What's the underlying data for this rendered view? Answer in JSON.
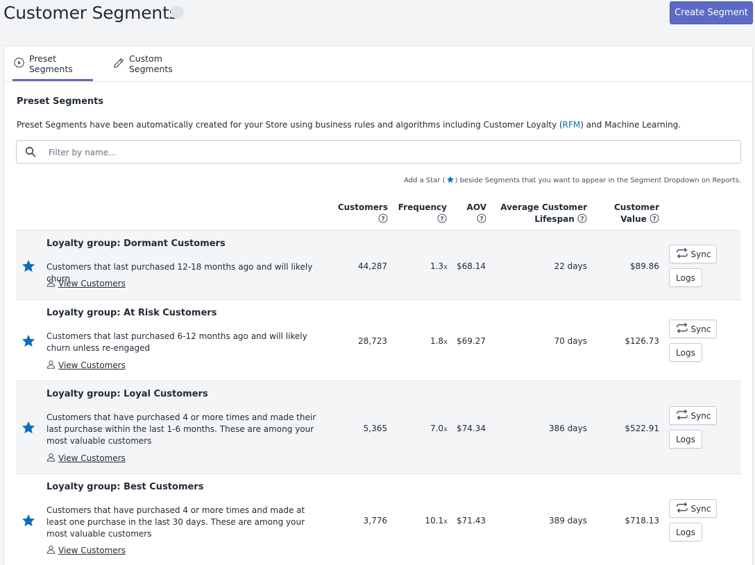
{
  "page": {
    "title": "Customer Segments",
    "create_button": "Create Segment"
  },
  "tabs": [
    {
      "label": "Preset Segments",
      "icon": "preset-icon",
      "active": true
    },
    {
      "label": "Custom Segments",
      "icon": "pencil-icon",
      "active": false
    }
  ],
  "section": {
    "heading": "Preset Segments",
    "desc_before": "Preset Segments have been automatically created for your Store using business rules and algorithms including Customer Loyalty (",
    "desc_link": "RFM",
    "desc_after": ") and Machine Learning."
  },
  "search": {
    "placeholder": "Filter by name...",
    "value": ""
  },
  "hint": {
    "before": "Add a Star (",
    "after": ") beside Segments that you want to appear in the Segment Dropdown on Reports."
  },
  "columns": {
    "customers": "Customers",
    "frequency": "Frequency",
    "aov": "AOV",
    "lifespan_line1": "Average Customer",
    "lifespan_line2": "Lifespan",
    "value_line1": "Customer",
    "value_line2": "Value"
  },
  "row_labels": {
    "view_customers": "View Customers",
    "sync": "Sync",
    "logs": "Logs",
    "freq_suffix": "x"
  },
  "rows": [
    {
      "title": "Loyalty group: Dormant Customers",
      "description": "Customers that last purchased 12-18 months ago and will likely churn",
      "customers": "44,287",
      "frequency": "1.3",
      "aov": "$68.14",
      "lifespan": "22 days",
      "value": "$89.86",
      "starred": true
    },
    {
      "title": "Loyalty group: At Risk Customers",
      "description": "Customers that last purchased 6-12 months ago and will likely churn unless re-engaged",
      "customers": "28,723",
      "frequency": "1.8",
      "aov": "$69.27",
      "lifespan": "70 days",
      "value": "$126.73",
      "starred": true
    },
    {
      "title": "Loyalty group: Loyal Customers",
      "description": "Customers that have purchased 4 or more times and made their last purchase within the last 1-6 months. These are among your most valuable customers",
      "customers": "5,365",
      "frequency": "7.0",
      "aov": "$74.34",
      "lifespan": "386 days",
      "value": "$522.91",
      "starred": true
    },
    {
      "title": "Loyalty group: Best Customers",
      "description": "Customers that have purchased 4 or more times and made at least one purchase in the last 30 days. These are among your most valuable customers",
      "customers": "3,776",
      "frequency": "10.1",
      "aov": "$71.43",
      "lifespan": "389 days",
      "value": "$718.13",
      "starred": true
    }
  ],
  "colors": {
    "accent": "#5c6ac4",
    "star": "#0b6dbb",
    "link": "#006fbb",
    "row_shade": "#f4f5f7"
  }
}
